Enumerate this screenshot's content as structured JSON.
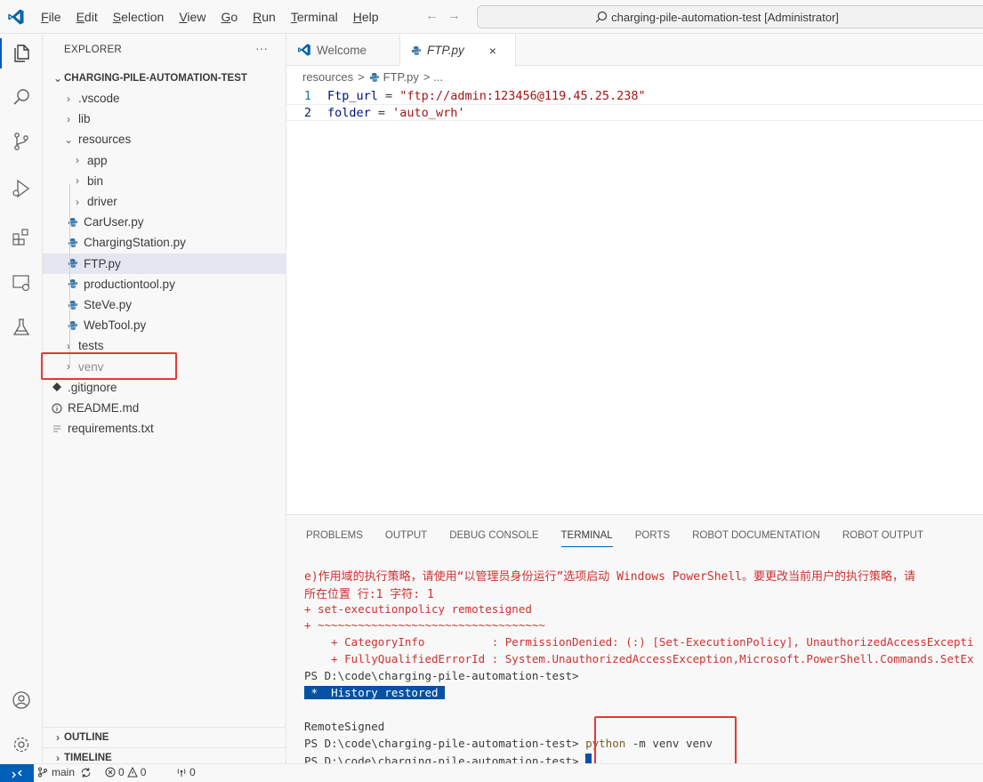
{
  "window": {
    "search_text": "charging-pile-automation-test [Administrator]"
  },
  "menu": [
    {
      "mnemonic": "F",
      "rest": "ile"
    },
    {
      "mnemonic": "E",
      "rest": "dit"
    },
    {
      "mnemonic": "S",
      "rest": "election"
    },
    {
      "mnemonic": "V",
      "rest": "iew"
    },
    {
      "mnemonic": "G",
      "rest": "o"
    },
    {
      "mnemonic": "R",
      "rest": "un"
    },
    {
      "mnemonic": "T",
      "rest": "erminal"
    },
    {
      "mnemonic": "H",
      "rest": "elp"
    }
  ],
  "explorer": {
    "header": "EXPLORER",
    "more": "···",
    "root": "CHARGING-PILE-AUTOMATION-TEST",
    "items": [
      {
        "label": ".vscode",
        "kind": "folder"
      },
      {
        "label": "lib",
        "kind": "folder"
      },
      {
        "label": "resources",
        "kind": "folder-open"
      },
      {
        "label": "app",
        "kind": "folder"
      },
      {
        "label": "bin",
        "kind": "folder"
      },
      {
        "label": "driver",
        "kind": "folder"
      },
      {
        "label": "CarUser.py",
        "kind": "python"
      },
      {
        "label": "ChargingStation.py",
        "kind": "python"
      },
      {
        "label": "FTP.py",
        "kind": "python"
      },
      {
        "label": "productiontool.py",
        "kind": "python"
      },
      {
        "label": "SteVe.py",
        "kind": "python"
      },
      {
        "label": "WebTool.py",
        "kind": "python"
      },
      {
        "label": "tests",
        "kind": "folder"
      },
      {
        "label": "venv",
        "kind": "folder"
      },
      {
        "label": ".gitignore",
        "kind": "git"
      },
      {
        "label": "README.md",
        "kind": "info"
      },
      {
        "label": "requirements.txt",
        "kind": "text"
      }
    ],
    "outline": "OUTLINE",
    "timeline": "TIMELINE"
  },
  "tabs": [
    {
      "label": "Welcome"
    },
    {
      "label": "FTP.py",
      "close": "×"
    }
  ],
  "breadcrumb": {
    "folder": "resources",
    "sep": ">",
    "file": "FTP.py",
    "more": "> ..."
  },
  "code": [
    {
      "num": "1",
      "var": "Ftp_url",
      "op": " = ",
      "str": "\"ftp://admin:123456@119.45.25.238\""
    },
    {
      "num": "2",
      "var": "folder",
      "op": " = ",
      "str": "'auto_wrh'"
    }
  ],
  "panel": {
    "tabs": [
      "PROBLEMS",
      "OUTPUT",
      "DEBUG CONSOLE",
      "TERMINAL",
      "PORTS",
      "ROBOT DOCUMENTATION",
      "ROBOT OUTPUT"
    ],
    "terminal": {
      "l1": "e)作用域的执行策略，请使用“以管理员身份运行”选项启动 Windows PowerShell。要更改当前用户的执行策略，请",
      "l2": "所在位置 行:1 字符: 1",
      "l3": "+ set-executionpolicy remotesigned",
      "l4": "+ ~~~~~~~~~~~~~~~~~~~~~~~~~~~~~~~~~~",
      "l5": "    + CategoryInfo          : PermissionDenied: (:) [Set-ExecutionPolicy], UnauthorizedAccessExcepti",
      "l6": "    + FullyQualifiedErrorId : System.UnauthorizedAccessException,Microsoft.PowerShell.Commands.SetEx",
      "l7": "PS D:\\code\\charging-pile-automation-test>",
      "history": " *  History restored ",
      "l9": "RemoteSigned",
      "prompt": "PS D:\\code\\charging-pile-automation-test>",
      "cmd_name": "python",
      "cmd_args": " -m venv venv"
    }
  },
  "status": {
    "branch": "main",
    "errors": "0",
    "warnings": "0",
    "ports": "0"
  }
}
